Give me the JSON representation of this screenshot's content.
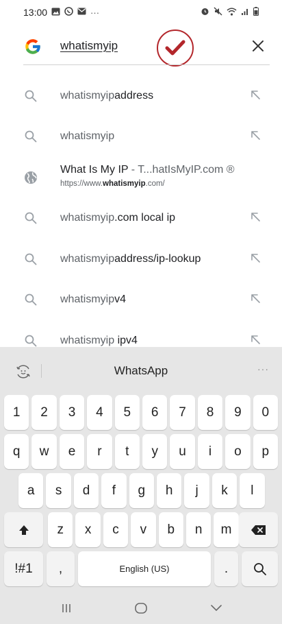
{
  "status_bar": {
    "time": "13:00",
    "left_icons": [
      "gallery-icon",
      "whatsapp-icon",
      "mail-icon"
    ],
    "overflow": "···",
    "right_icons": [
      "alarm-icon",
      "mute-icon",
      "wifi-icon",
      "signal-icon",
      "battery-icon"
    ]
  },
  "search": {
    "query": "whatismyip",
    "accent_color": "#b3262b"
  },
  "suggestions": [
    {
      "type": "query",
      "prefix": "whatismyip",
      "suffix": "address"
    },
    {
      "type": "query",
      "prefix": "whatismyip",
      "suffix": ""
    },
    {
      "type": "site",
      "title_bold": "What Is My IP",
      "title_rest": " - T...hatIsMyIP.com ®",
      "url_pre": "https://www.",
      "url_bold": "whatismyip",
      "url_post": ".com/"
    },
    {
      "type": "query",
      "prefix": "whatismyip",
      "suffix": ".com local ip"
    },
    {
      "type": "query",
      "prefix": "whatismyip",
      "suffix": "address/ip-lookup"
    },
    {
      "type": "query",
      "prefix": "whatismyip",
      "suffix": "v4"
    },
    {
      "type": "query",
      "prefix": "whatismyip",
      "suffix": " ipv4"
    }
  ],
  "keyboard": {
    "suggestion": "WhatsApp",
    "more": "···",
    "row_numbers": [
      "1",
      "2",
      "3",
      "4",
      "5",
      "6",
      "7",
      "8",
      "9",
      "0"
    ],
    "row_top": [
      "q",
      "w",
      "e",
      "r",
      "t",
      "y",
      "u",
      "i",
      "o",
      "p"
    ],
    "row_home": [
      "a",
      "s",
      "d",
      "f",
      "g",
      "h",
      "j",
      "k",
      "l"
    ],
    "row_bottom": [
      "z",
      "x",
      "c",
      "v",
      "b",
      "n",
      "m"
    ],
    "symbols_key": "!#1",
    "comma_key": ",",
    "space_label": "English (US)",
    "period_key": "."
  }
}
